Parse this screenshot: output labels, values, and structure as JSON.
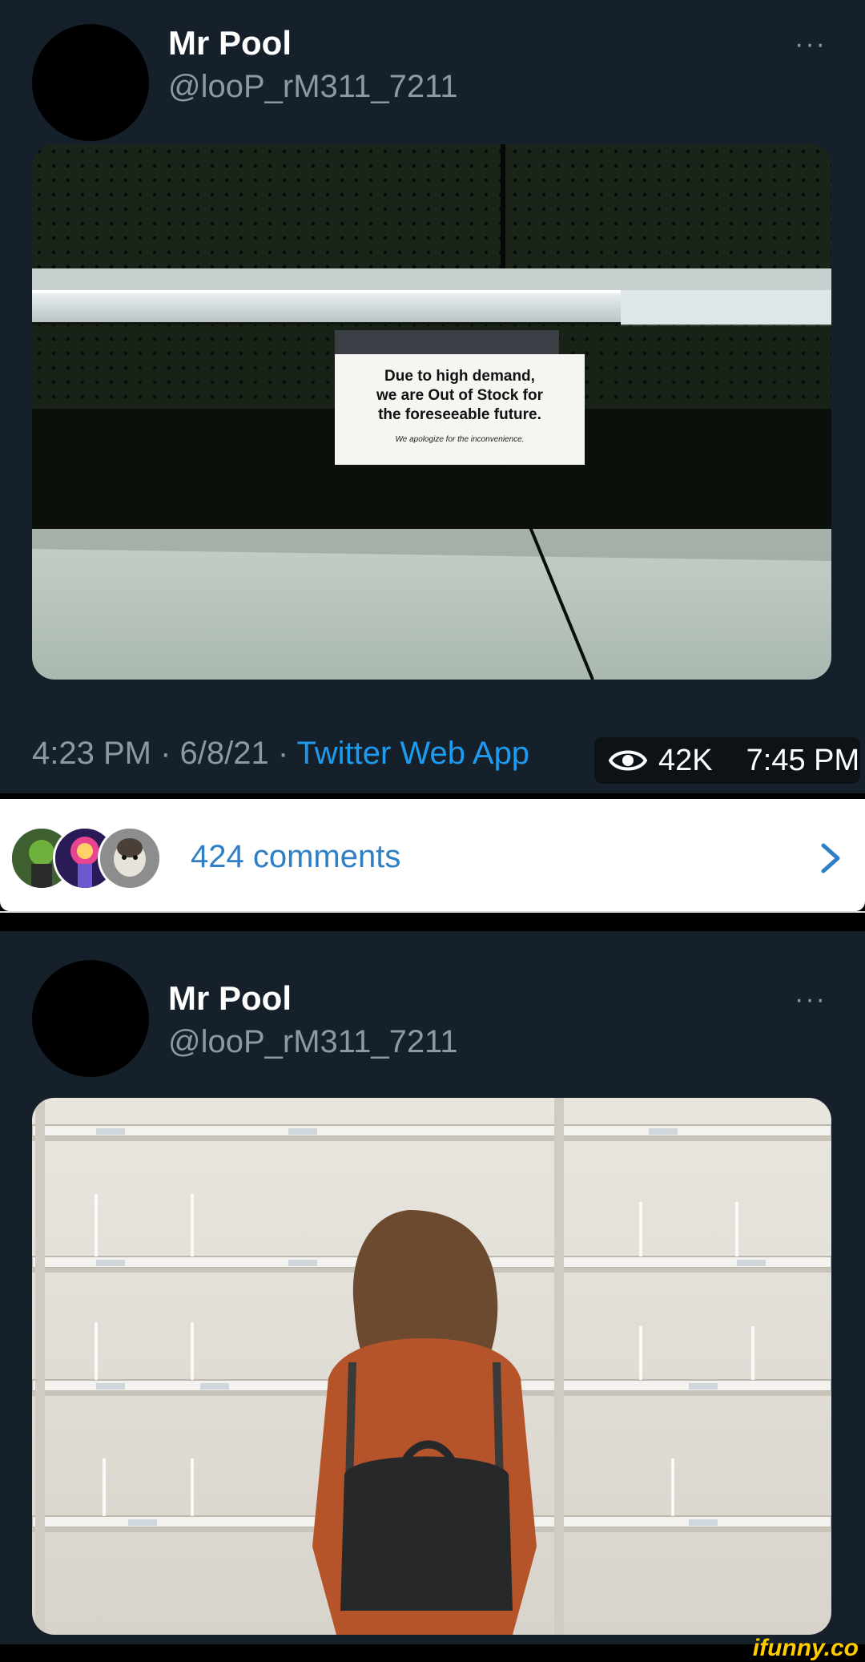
{
  "tweet1": {
    "author_name": "Mr Pool",
    "author_handle": "@looP_rM311_7211",
    "more_label": "···",
    "image": {
      "sign_line1": "Due to high demand,",
      "sign_line2": "we are Out of Stock for",
      "sign_line3": "the foreseeable future.",
      "sign_line4": "We apologize for the inconvenience."
    },
    "timestamp": "4:23 PM · 6/8/21 · ",
    "source_app": "Twitter Web App"
  },
  "overlay": {
    "eye_icon": "eye-icon",
    "views": "42K",
    "time": "7:45 PM"
  },
  "comments": {
    "count_label": "424 comments",
    "chevron_icon": "chevron-right-icon"
  },
  "tweet2": {
    "author_name": "Mr Pool",
    "author_handle": "@looP_rM311_7211",
    "more_label": "···"
  },
  "watermark": "ifunny.co",
  "colors": {
    "tweet_bg": "#15202b",
    "link_blue": "#1d9bf0",
    "muted": "#8b98a5",
    "comments_blue": "#2f7fc7"
  }
}
